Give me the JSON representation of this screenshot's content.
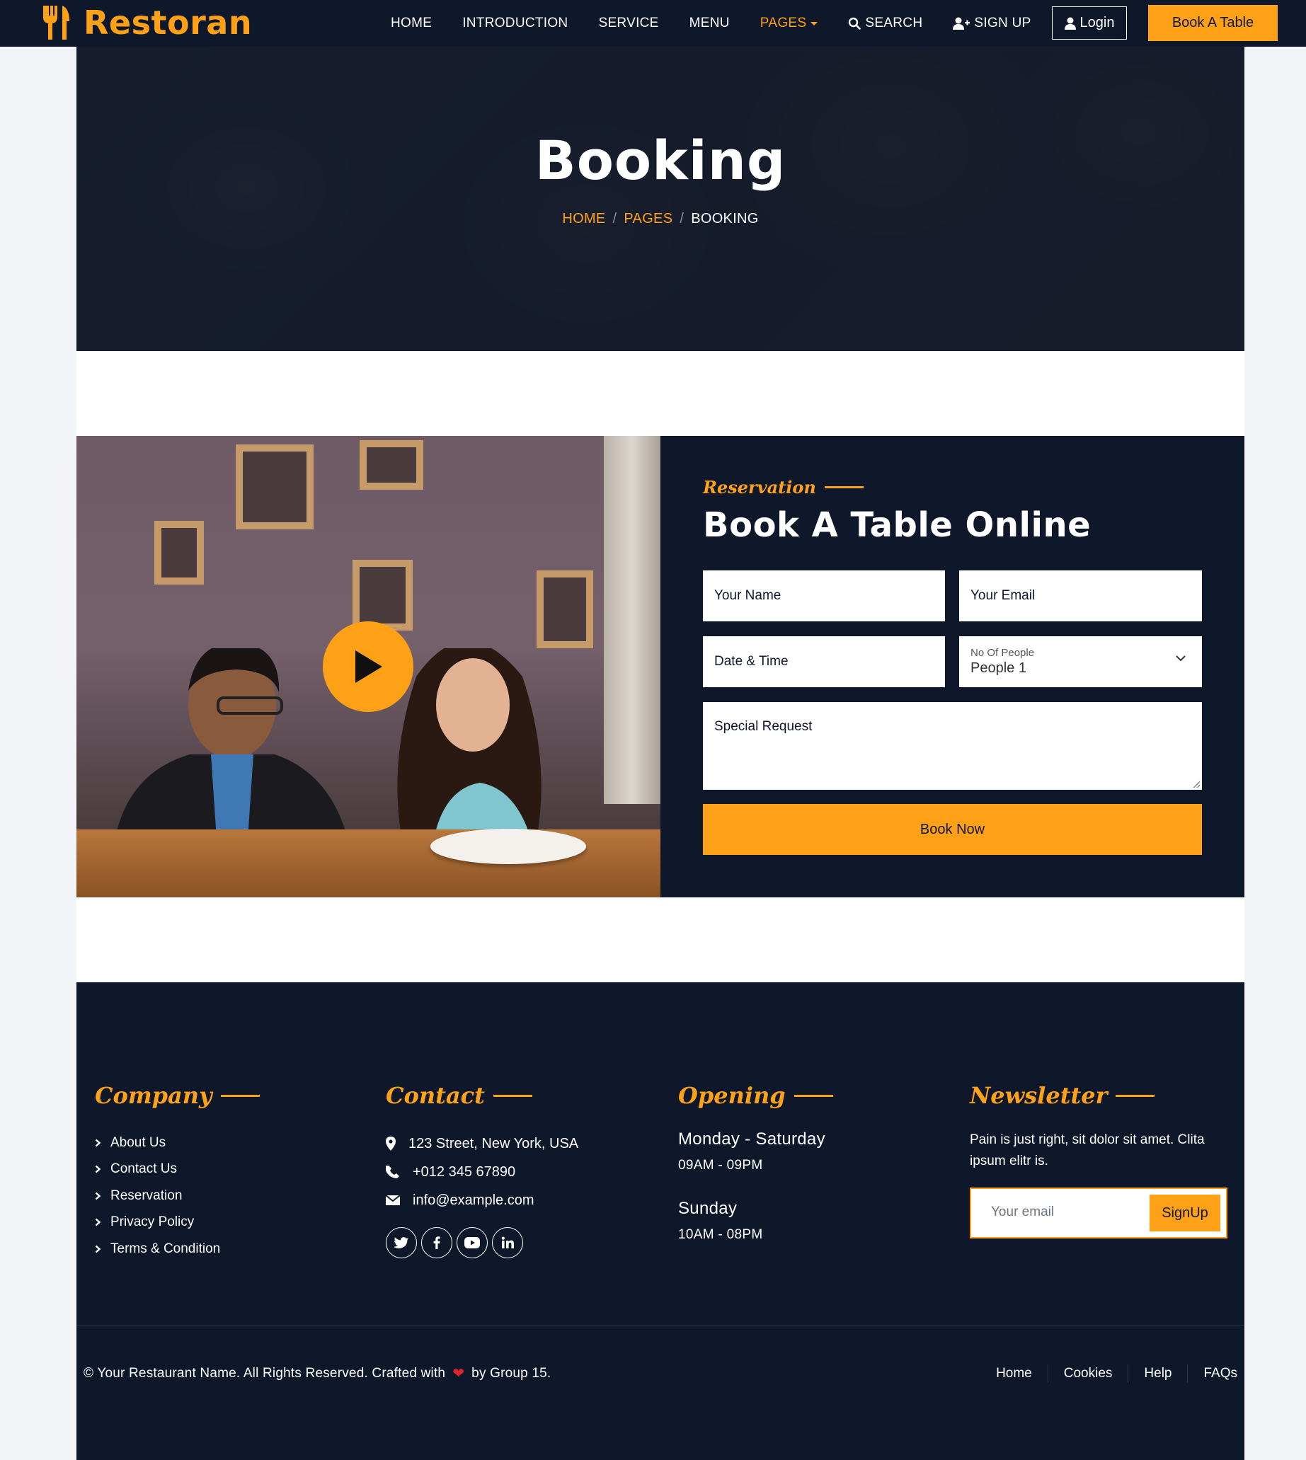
{
  "navbar": {
    "brand": "Restoran",
    "links": [
      "HOME",
      "INTRODUCTION",
      "SERVICE",
      "MENU",
      "PAGES",
      "SEARCH",
      "SIGN UP"
    ],
    "login": "Login",
    "book_table": "Book A Table",
    "accent": "#fea116",
    "dark": "#0f172b"
  },
  "hero": {
    "title": "Booking",
    "breadcrumb": [
      "HOME",
      "PAGES",
      "BOOKING"
    ],
    "separator": "/"
  },
  "booking": {
    "tag": "Reservation",
    "heading": "Book A Table Online",
    "name_placeholder": "Your Name",
    "email_placeholder": "Your Email",
    "datetime_placeholder": "Date & Time",
    "people_label": "No Of People",
    "people_value": "People 1",
    "request_placeholder": "Special Request",
    "submit": "Book Now"
  },
  "footer": {
    "company": {
      "heading": "Company",
      "items": [
        "About Us",
        "Contact Us",
        "Reservation",
        "Privacy Policy",
        "Terms & Condition"
      ]
    },
    "contact": {
      "heading": "Contact",
      "address": "123 Street, New York, USA",
      "phone": "+012 345 67890",
      "email": "info@example.com",
      "socials": [
        "twitter-icon",
        "facebook-icon",
        "youtube-icon",
        "linkedin-icon"
      ]
    },
    "opening": {
      "heading": "Opening",
      "day1": "Monday - Saturday",
      "hours1": "09AM - 09PM",
      "day2": "Sunday",
      "hours2": "10AM - 08PM"
    },
    "newsletter": {
      "heading": "Newsletter",
      "text": "Pain is just right, sit dolor sit amet. Clita ipsum elitr is.",
      "placeholder": "Your email",
      "button": "SignUp"
    },
    "copyright_before": "© Your Restaurant Name. All Rights Reserved. Crafted with",
    "copyright_after": "by Group 15.",
    "menu": [
      "Home",
      "Cookies",
      "Help",
      "FAQs"
    ]
  }
}
